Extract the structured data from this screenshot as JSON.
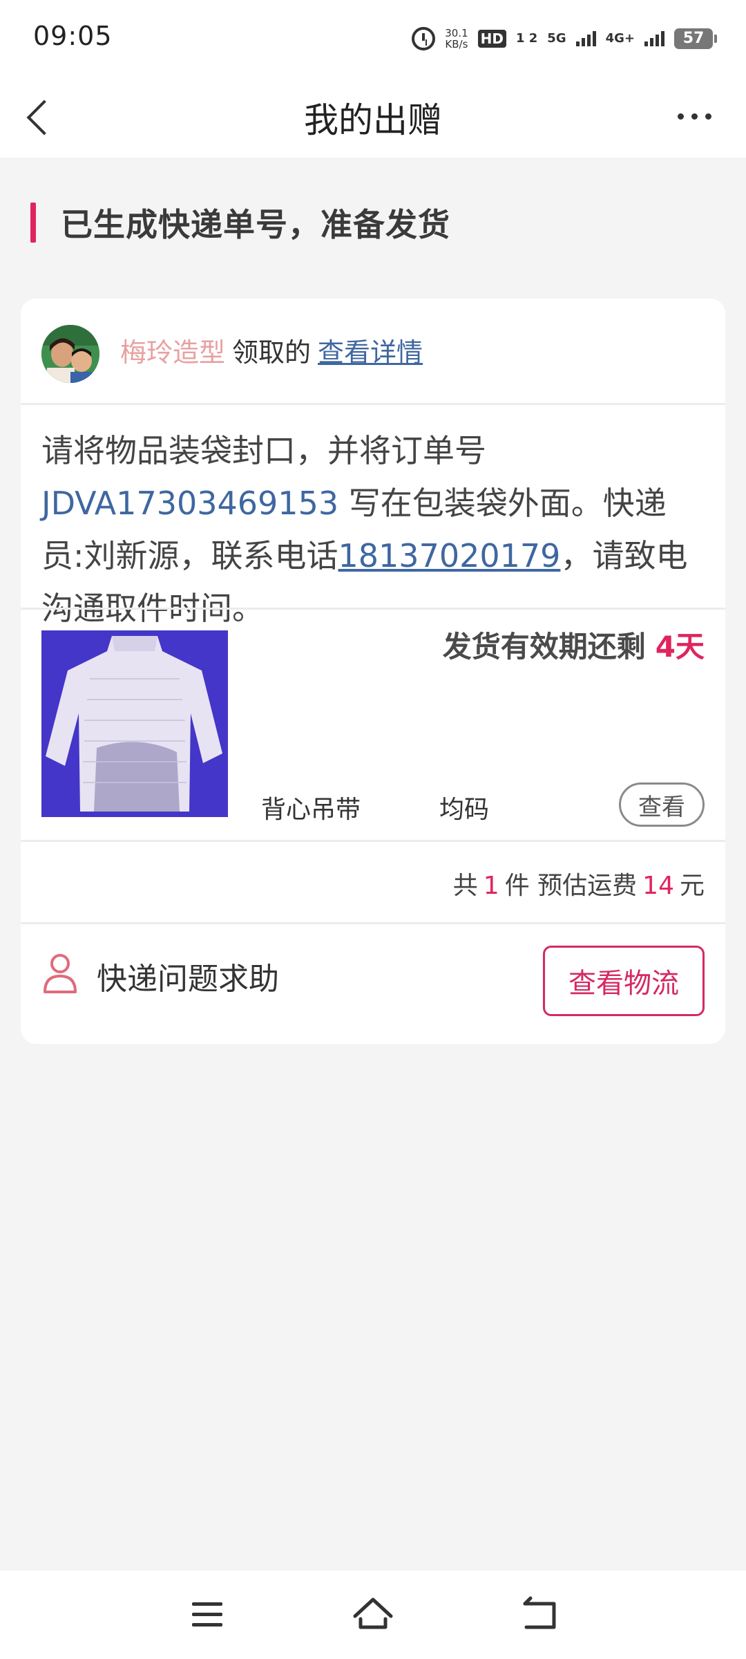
{
  "status_bar": {
    "time": "09:05",
    "speed_value": "30.1",
    "speed_unit": "KB/s",
    "hd_badge": "HD",
    "sim_labels": "1 2",
    "network_5g": "5G",
    "network_4g": "4G+",
    "battery": "57"
  },
  "nav": {
    "title": "我的出赠"
  },
  "section": {
    "title": "已生成快递单号，准备发货"
  },
  "claim": {
    "claimer": "梅玲造型",
    "verb": "领取的",
    "detail_link": "查看详情"
  },
  "instruction": {
    "before_order": "请将物品装袋封口，并将订单号 ",
    "order_no": "JDVA17303469153",
    "after_order": " 写在包装袋外面。快递员:刘新源，联系电话",
    "phone": "18137020179",
    "after_phone": "，请致电沟通取件时间。"
  },
  "item": {
    "deadline_label": "发货有效期还剩",
    "deadline_value": "4天",
    "category": "背心吊带",
    "size": "均码",
    "view_label": "查看"
  },
  "summary": {
    "prefix": "共",
    "count": "1",
    "count_unit": "件",
    "fee_label": "预估运费",
    "fee": "14",
    "fee_unit": "元"
  },
  "help": {
    "label": "快递问题求助"
  },
  "logistics": {
    "label": "查看物流"
  },
  "colors": {
    "accent": "#e0245e",
    "link": "#3f67a0",
    "claimer": "#e8a0a0",
    "background": "#f4f4f4"
  },
  "icons": {
    "back": "chevron-left-icon",
    "more": "more-dots-icon",
    "help": "person-icon",
    "menu": "menu-icon",
    "home": "home-icon",
    "sys_back": "back-icon"
  }
}
